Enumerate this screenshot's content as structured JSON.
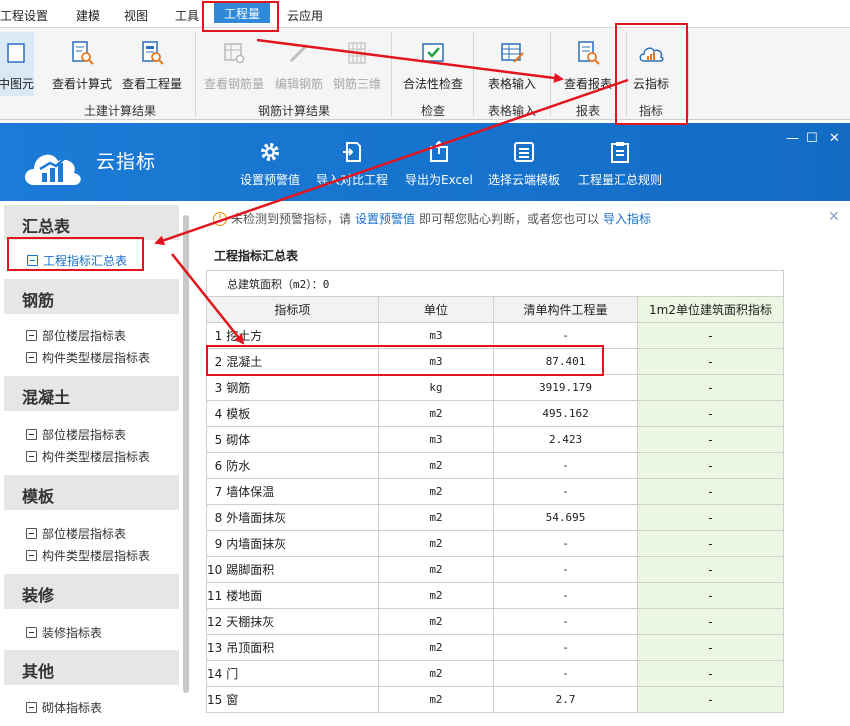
{
  "menu": {
    "items": [
      "工程设置",
      "建模",
      "视图",
      "工具",
      "工程量",
      "云应用"
    ],
    "active_index": 4
  },
  "ribbon": {
    "left_partial_label": "中图元",
    "buttons": {
      "view_formula": "查看计算式",
      "view_quantity": "查看工程量",
      "view_rebar_qty": "查看钢筋量",
      "edit_rebar": "编辑钢筋",
      "rebar_3d": "钢筋三维",
      "legality_check": "合法性检查",
      "table_input": "表格输入",
      "view_report": "查看报表",
      "cloud_index": "云指标"
    },
    "groups": {
      "civil": "土建计算结果",
      "rebar": "钢筋计算结果",
      "check": "检查",
      "table": "表格输入",
      "report": "报表",
      "index": "指标"
    }
  },
  "cloud": {
    "title": "云指标",
    "toolbar": {
      "set_warning": "设置预警值",
      "import_compare": "导入对比工程",
      "export_excel": "导出为Excel",
      "choose_template": "选择云端模板",
      "summary_rules": "工程量汇总规则"
    },
    "window_controls": {
      "min": "—",
      "max": "☐",
      "close": "✕"
    }
  },
  "sidebar": {
    "sections": [
      {
        "title": "汇总表",
        "items": [
          "工程指标汇总表"
        ]
      },
      {
        "title": "钢筋",
        "items": [
          "部位楼层指标表",
          "构件类型楼层指标表"
        ]
      },
      {
        "title": "混凝土",
        "items": [
          "部位楼层指标表",
          "构件类型楼层指标表"
        ]
      },
      {
        "title": "模板",
        "items": [
          "部位楼层指标表",
          "构件类型楼层指标表"
        ]
      },
      {
        "title": "装修",
        "items": [
          "装修指标表"
        ]
      },
      {
        "title": "其他",
        "items": [
          "砌体指标表"
        ]
      }
    ],
    "active_item": "工程指标汇总表"
  },
  "notice": {
    "text_before": "未检测到预警指标，请",
    "link_set": "设置预警值",
    "text_middle": "即可帮您贴心判断，或者您也可以",
    "link_import": "导入指标",
    "close": "✕"
  },
  "table": {
    "title": "工程指标汇总表",
    "area_label": "总建筑面积（m2）：0",
    "columns": [
      "指标项",
      "单位",
      "清单构件工程量",
      "1m2单位建筑面积指标"
    ],
    "rows": [
      {
        "no": "1",
        "name": "挖土方",
        "unit": "m3",
        "qty": "-",
        "index": "-"
      },
      {
        "no": "2",
        "name": "混凝土",
        "unit": "m3",
        "qty": "87.401",
        "index": "-"
      },
      {
        "no": "3",
        "name": "钢筋",
        "unit": "kg",
        "qty": "3919.179",
        "index": "-"
      },
      {
        "no": "4",
        "name": "模板",
        "unit": "m2",
        "qty": "495.162",
        "index": "-"
      },
      {
        "no": "5",
        "name": "砌体",
        "unit": "m3",
        "qty": "2.423",
        "index": "-"
      },
      {
        "no": "6",
        "name": "防水",
        "unit": "m2",
        "qty": "-",
        "index": "-"
      },
      {
        "no": "7",
        "name": "墙体保温",
        "unit": "m2",
        "qty": "-",
        "index": "-"
      },
      {
        "no": "8",
        "name": "外墙面抹灰",
        "unit": "m2",
        "qty": "54.695",
        "index": "-"
      },
      {
        "no": "9",
        "name": "内墙面抹灰",
        "unit": "m2",
        "qty": "-",
        "index": "-"
      },
      {
        "no": "10",
        "name": "踢脚面积",
        "unit": "m2",
        "qty": "-",
        "index": "-"
      },
      {
        "no": "11",
        "name": "楼地面",
        "unit": "m2",
        "qty": "-",
        "index": "-"
      },
      {
        "no": "12",
        "name": "天棚抹灰",
        "unit": "m2",
        "qty": "-",
        "index": "-"
      },
      {
        "no": "13",
        "name": "吊顶面积",
        "unit": "m2",
        "qty": "-",
        "index": "-"
      },
      {
        "no": "14",
        "name": "门",
        "unit": "m2",
        "qty": "-",
        "index": "-"
      },
      {
        "no": "15",
        "name": "窗",
        "unit": "m2",
        "qty": "2.7",
        "index": "-"
      }
    ]
  },
  "colors": {
    "accent_blue": "#1b7bd6",
    "annotation_red": "#e2141e",
    "index_column_green": "#ebf7e2"
  }
}
